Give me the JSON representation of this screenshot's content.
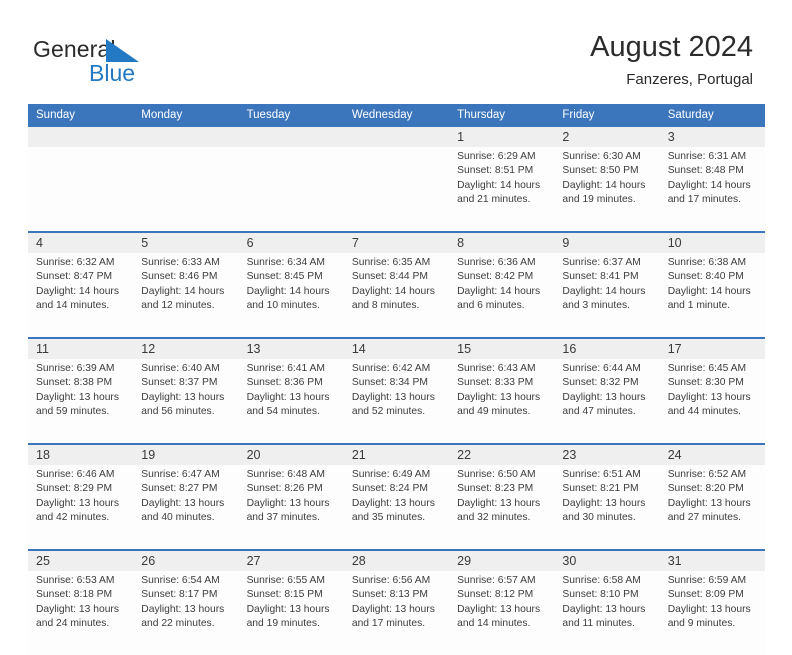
{
  "brand": {
    "word_general": "General",
    "word_blue": "Blue",
    "flag_color": "#2379c4"
  },
  "header": {
    "title": "August 2024",
    "subtitle": "Fanzeres, Portugal"
  },
  "theme": {
    "header_blue": "#3b76bc",
    "daynum_band": "#efefef",
    "cell_bg": "#fdfdfd",
    "text": "#3d3d3d"
  },
  "weekday_headers": [
    "Sunday",
    "Monday",
    "Tuesday",
    "Wednesday",
    "Thursday",
    "Friday",
    "Saturday"
  ],
  "weeks": [
    {
      "days": [
        {
          "num": "",
          "lines": [
            "",
            "",
            "",
            ""
          ]
        },
        {
          "num": "",
          "lines": [
            "",
            "",
            "",
            ""
          ]
        },
        {
          "num": "",
          "lines": [
            "",
            "",
            "",
            ""
          ]
        },
        {
          "num": "",
          "lines": [
            "",
            "",
            "",
            ""
          ]
        },
        {
          "num": "1",
          "lines": [
            "Sunrise: 6:29 AM",
            "Sunset: 8:51 PM",
            "Daylight: 14 hours",
            "and 21 minutes."
          ]
        },
        {
          "num": "2",
          "lines": [
            "Sunrise: 6:30 AM",
            "Sunset: 8:50 PM",
            "Daylight: 14 hours",
            "and 19 minutes."
          ]
        },
        {
          "num": "3",
          "lines": [
            "Sunrise: 6:31 AM",
            "Sunset: 8:48 PM",
            "Daylight: 14 hours",
            "and 17 minutes."
          ]
        }
      ]
    },
    {
      "days": [
        {
          "num": "4",
          "lines": [
            "Sunrise: 6:32 AM",
            "Sunset: 8:47 PM",
            "Daylight: 14 hours",
            "and 14 minutes."
          ]
        },
        {
          "num": "5",
          "lines": [
            "Sunrise: 6:33 AM",
            "Sunset: 8:46 PM",
            "Daylight: 14 hours",
            "and 12 minutes."
          ]
        },
        {
          "num": "6",
          "lines": [
            "Sunrise: 6:34 AM",
            "Sunset: 8:45 PM",
            "Daylight: 14 hours",
            "and 10 minutes."
          ]
        },
        {
          "num": "7",
          "lines": [
            "Sunrise: 6:35 AM",
            "Sunset: 8:44 PM",
            "Daylight: 14 hours",
            "and 8 minutes."
          ]
        },
        {
          "num": "8",
          "lines": [
            "Sunrise: 6:36 AM",
            "Sunset: 8:42 PM",
            "Daylight: 14 hours",
            "and 6 minutes."
          ]
        },
        {
          "num": "9",
          "lines": [
            "Sunrise: 6:37 AM",
            "Sunset: 8:41 PM",
            "Daylight: 14 hours",
            "and 3 minutes."
          ]
        },
        {
          "num": "10",
          "lines": [
            "Sunrise: 6:38 AM",
            "Sunset: 8:40 PM",
            "Daylight: 14 hours",
            "and 1 minute."
          ]
        }
      ]
    },
    {
      "days": [
        {
          "num": "11",
          "lines": [
            "Sunrise: 6:39 AM",
            "Sunset: 8:38 PM",
            "Daylight: 13 hours",
            "and 59 minutes."
          ]
        },
        {
          "num": "12",
          "lines": [
            "Sunrise: 6:40 AM",
            "Sunset: 8:37 PM",
            "Daylight: 13 hours",
            "and 56 minutes."
          ]
        },
        {
          "num": "13",
          "lines": [
            "Sunrise: 6:41 AM",
            "Sunset: 8:36 PM",
            "Daylight: 13 hours",
            "and 54 minutes."
          ]
        },
        {
          "num": "14",
          "lines": [
            "Sunrise: 6:42 AM",
            "Sunset: 8:34 PM",
            "Daylight: 13 hours",
            "and 52 minutes."
          ]
        },
        {
          "num": "15",
          "lines": [
            "Sunrise: 6:43 AM",
            "Sunset: 8:33 PM",
            "Daylight: 13 hours",
            "and 49 minutes."
          ]
        },
        {
          "num": "16",
          "lines": [
            "Sunrise: 6:44 AM",
            "Sunset: 8:32 PM",
            "Daylight: 13 hours",
            "and 47 minutes."
          ]
        },
        {
          "num": "17",
          "lines": [
            "Sunrise: 6:45 AM",
            "Sunset: 8:30 PM",
            "Daylight: 13 hours",
            "and 44 minutes."
          ]
        }
      ]
    },
    {
      "days": [
        {
          "num": "18",
          "lines": [
            "Sunrise: 6:46 AM",
            "Sunset: 8:29 PM",
            "Daylight: 13 hours",
            "and 42 minutes."
          ]
        },
        {
          "num": "19",
          "lines": [
            "Sunrise: 6:47 AM",
            "Sunset: 8:27 PM",
            "Daylight: 13 hours",
            "and 40 minutes."
          ]
        },
        {
          "num": "20",
          "lines": [
            "Sunrise: 6:48 AM",
            "Sunset: 8:26 PM",
            "Daylight: 13 hours",
            "and 37 minutes."
          ]
        },
        {
          "num": "21",
          "lines": [
            "Sunrise: 6:49 AM",
            "Sunset: 8:24 PM",
            "Daylight: 13 hours",
            "and 35 minutes."
          ]
        },
        {
          "num": "22",
          "lines": [
            "Sunrise: 6:50 AM",
            "Sunset: 8:23 PM",
            "Daylight: 13 hours",
            "and 32 minutes."
          ]
        },
        {
          "num": "23",
          "lines": [
            "Sunrise: 6:51 AM",
            "Sunset: 8:21 PM",
            "Daylight: 13 hours",
            "and 30 minutes."
          ]
        },
        {
          "num": "24",
          "lines": [
            "Sunrise: 6:52 AM",
            "Sunset: 8:20 PM",
            "Daylight: 13 hours",
            "and 27 minutes."
          ]
        }
      ]
    },
    {
      "days": [
        {
          "num": "25",
          "lines": [
            "Sunrise: 6:53 AM",
            "Sunset: 8:18 PM",
            "Daylight: 13 hours",
            "and 24 minutes."
          ]
        },
        {
          "num": "26",
          "lines": [
            "Sunrise: 6:54 AM",
            "Sunset: 8:17 PM",
            "Daylight: 13 hours",
            "and 22 minutes."
          ]
        },
        {
          "num": "27",
          "lines": [
            "Sunrise: 6:55 AM",
            "Sunset: 8:15 PM",
            "Daylight: 13 hours",
            "and 19 minutes."
          ]
        },
        {
          "num": "28",
          "lines": [
            "Sunrise: 6:56 AM",
            "Sunset: 8:13 PM",
            "Daylight: 13 hours",
            "and 17 minutes."
          ]
        },
        {
          "num": "29",
          "lines": [
            "Sunrise: 6:57 AM",
            "Sunset: 8:12 PM",
            "Daylight: 13 hours",
            "and 14 minutes."
          ]
        },
        {
          "num": "30",
          "lines": [
            "Sunrise: 6:58 AM",
            "Sunset: 8:10 PM",
            "Daylight: 13 hours",
            "and 11 minutes."
          ]
        },
        {
          "num": "31",
          "lines": [
            "Sunrise: 6:59 AM",
            "Sunset: 8:09 PM",
            "Daylight: 13 hours",
            "and 9 minutes."
          ]
        }
      ]
    }
  ]
}
